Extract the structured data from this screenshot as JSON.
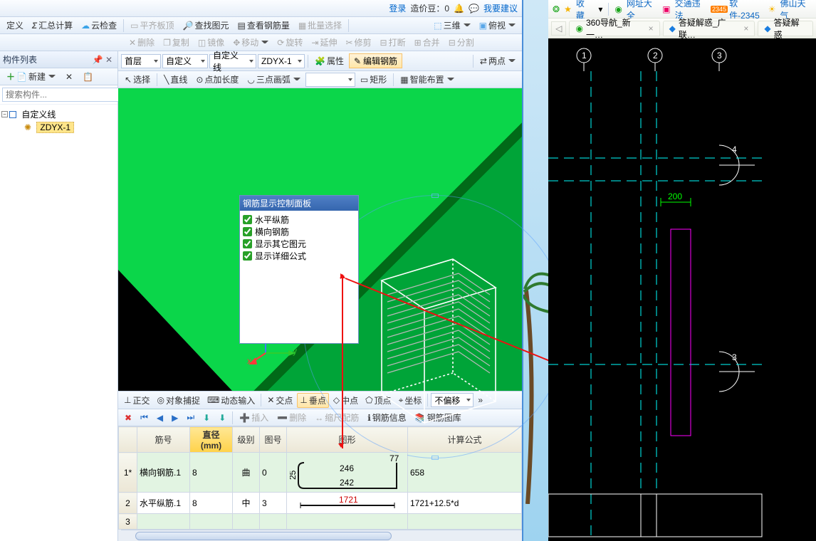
{
  "top": {
    "login": "登录",
    "bean": "造价豆：0",
    "suggest": "我要建议"
  },
  "tb1": {
    "dingyi": "定义",
    "huizong": "汇总计算",
    "yunjc": "云检查",
    "pingqi": "平齐板顶",
    "chazhao": "查找图元",
    "chakan": "查看钢筋量",
    "piliang": "批量选择",
    "sanwei": "三维",
    "fushi": "俯视"
  },
  "tb2": {
    "shanchu": "删除",
    "fuzhi": "复制",
    "jingxiang": "镜像",
    "yidong": "移动",
    "xuanzhuan": "旋转",
    "yanshen": "延伸",
    "xiujian": "修剪",
    "dadan": "打断",
    "hebing": "合并",
    "fenge": "分割"
  },
  "sidebar": {
    "title": "构件列表",
    "new": "新建",
    "placeholder": "搜索构件...",
    "root": "自定义线",
    "leaf": "ZDYX-1"
  },
  "mtb": {
    "floor": "首层",
    "cat": "自定义",
    "item": "自定义线",
    "id": "ZDYX-1",
    "shuxing": "属性",
    "bianji": "编辑钢筋",
    "liangdian": "两点"
  },
  "mtb2": {
    "xuanze": "选择",
    "zhixian": "直线",
    "dianjia": "点加长度",
    "sandian": "三点画弧",
    "juxing": "矩形",
    "zhineng": "智能布置"
  },
  "float": {
    "title": "钢筋显示控制面板",
    "c1": "水平纵筋",
    "c2": "横向钢筋",
    "c3": "显示其它图元",
    "c4": "显示详细公式"
  },
  "snap": {
    "zhengjiao": "正交",
    "duixiang": "对象捕捉",
    "dongtai": "动态输入",
    "jiaodian": "交点",
    "chuidian": "垂点",
    "zhongdian": "中点",
    "dingdian": "顶点",
    "zuobiao": "坐标",
    "bupianyi": "不偏移"
  },
  "gtb": {
    "charu": "插入",
    "shanchu": "删除",
    "suochi": "缩尺配筋",
    "gangjin": "钢筋信息",
    "tuku": "钢筋图库"
  },
  "cols": {
    "jinhao": "筋号",
    "zhijing": "直径(mm)",
    "jibie": "级别",
    "tuhao": "图号",
    "tuxing": "图形",
    "jisuan": "计算公式"
  },
  "rows": [
    {
      "n": "1*",
      "name": "横向钢筋.1",
      "d": "8",
      "lvl": "曲",
      "th": "0",
      "rvals": {
        "a": "25",
        "b": "246",
        "c": "242",
        "t": "77"
      },
      "calc": "658"
    },
    {
      "n": "2",
      "name": "水平纵筋.1",
      "d": "8",
      "lvl": "中",
      "th": "3",
      "len": "1721",
      "calc": "1721+12.5*d"
    },
    {
      "n": "3",
      "name": "",
      "d": "",
      "lvl": "",
      "th": "",
      "calc": ""
    }
  ],
  "browser": {
    "fav": "收藏",
    "net": "网址大全",
    "traffic": "交通违法",
    "soft": "软件-2345",
    "foshan": "佛山天气",
    "t1": "360导航_新一…",
    "t2": "答疑解惑_广联…",
    "t3": "答疑解惑"
  },
  "cad": {
    "dim": "200",
    "g1": "1",
    "g2": "2",
    "g3": "3",
    "b3": "3",
    "b4": "4"
  }
}
